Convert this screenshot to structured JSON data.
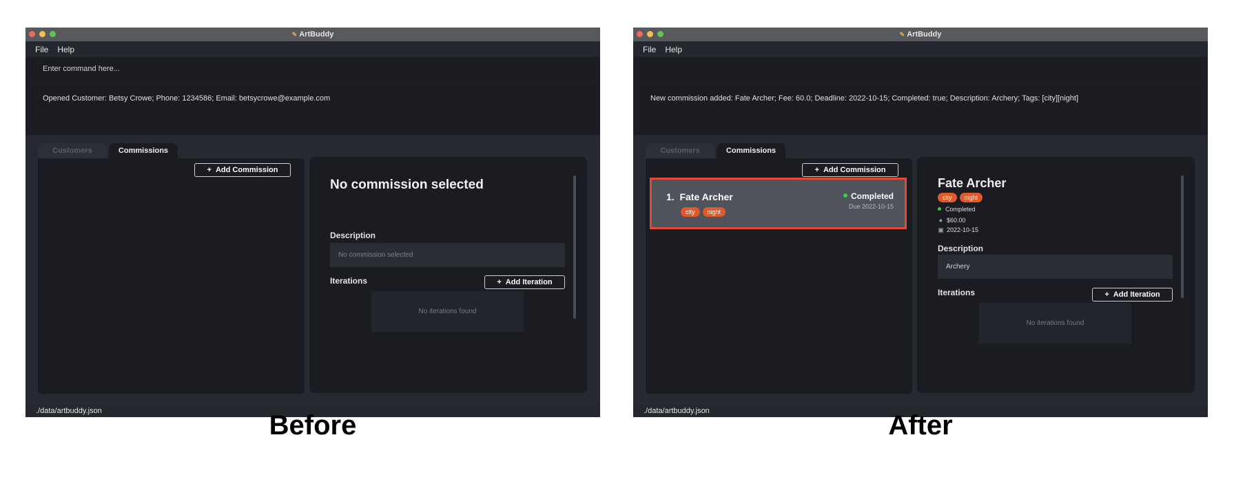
{
  "before": {
    "window_title": "ArtBuddy",
    "menu": [
      "File",
      "Help"
    ],
    "command_placeholder": "Enter command here...",
    "command_value": "",
    "result_text": "Opened Customer: Betsy Crowe; Phone: 1234586; Email: betsycrowe@example.com",
    "tabs": [
      {
        "label": "Customers"
      },
      {
        "label": "Commissions"
      }
    ],
    "add_commission_label": "Add Commission",
    "detail": {
      "title": "No commission selected",
      "description_label": "Description",
      "description_value": "No commission selected",
      "iterations_label": "Iterations",
      "add_iteration_label": "Add Iteration",
      "iterations_empty": "No iterations found"
    },
    "status_path": "./data/artbuddy.json",
    "caption": "Before"
  },
  "after": {
    "window_title": "ArtBuddy",
    "menu": [
      "File",
      "Help"
    ],
    "command_value": "",
    "result_text": "New commission added: Fate Archer; Fee: 60.0; Deadline: 2022-10-15; Completed: true; Description: Archery; Tags: [city][night]",
    "tabs": [
      {
        "label": "Customers"
      },
      {
        "label": "Commissions"
      }
    ],
    "add_commission_label": "Add Commission",
    "commissions": [
      {
        "index": "1.",
        "name": "Fate Archer",
        "status": "Completed",
        "due": "Due 2022-10-15",
        "tags": [
          "city",
          "night"
        ],
        "selected": true
      }
    ],
    "detail": {
      "title": "Fate Archer",
      "tags": [
        "city",
        "night"
      ],
      "status": "Completed",
      "fee": "$60.00",
      "deadline": "2022-10-15",
      "description_label": "Description",
      "description_value": "Archery",
      "iterations_label": "Iterations",
      "add_iteration_label": "Add Iteration",
      "iterations_empty": "No iterations found"
    },
    "status_path": "./data/artbuddy.json",
    "caption": "After"
  },
  "colors": {
    "tag": "#e0592a",
    "selection_border": "#e24c36",
    "status_dot": "#3fc94d",
    "window_bg": "#1c1e24"
  },
  "icons": {
    "app": "artbuddy-logo-icon",
    "fee": "money-bag-icon",
    "deadline": "calendar-icon",
    "add": "plus-icon"
  }
}
